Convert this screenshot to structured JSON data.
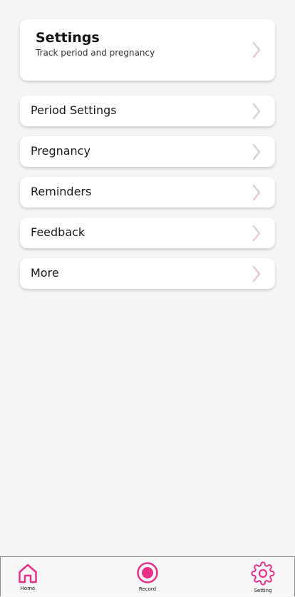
{
  "colors": {
    "accent": "#e8308a",
    "chevron": "#e2cfd6",
    "background": "#f5f5f5",
    "card": "#ffffff"
  },
  "header": {
    "title": "Settings",
    "subtitle": "Track period and pregnancy",
    "chevron_icon": "chevron-right-icon"
  },
  "menu": {
    "items": [
      {
        "label": "Period Settings",
        "icon": "chevron-right-icon"
      },
      {
        "label": "Pregnancy",
        "icon": "chevron-right-icon"
      },
      {
        "label": "Reminders",
        "icon": "chevron-right-icon"
      },
      {
        "label": "Feedback",
        "icon": "chevron-right-icon"
      },
      {
        "label": "More",
        "icon": "chevron-right-icon"
      }
    ]
  },
  "nav": {
    "items": [
      {
        "label": "Home",
        "icon": "home-icon"
      },
      {
        "label": "Record",
        "icon": "record-icon"
      },
      {
        "label": "Setting",
        "icon": "gear-icon"
      }
    ]
  }
}
